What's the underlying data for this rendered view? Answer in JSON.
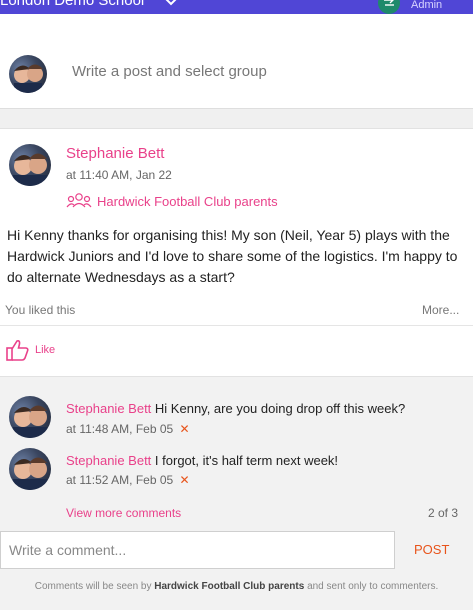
{
  "header": {
    "school_name": "London Demo School",
    "admin_label": "Admin",
    "bar_color": "#5046d6"
  },
  "composer": {
    "placeholder": "Write a post and select group"
  },
  "post": {
    "author": "Stephanie Bett",
    "time": "at 11:40 AM, Jan 22",
    "group": "Hardwick Football Club parents",
    "body": "Hi Kenny thanks for organising this! My son (Neil, Year 5) plays with the Hardwick Juniors and I'd love to share some of the logistics. I'm happy to do alternate Wednesdays as a start?",
    "liked_text": "You liked this",
    "more_label": "More...",
    "like_label": "Like"
  },
  "comments": {
    "items": [
      {
        "author": "Stephanie Bett",
        "text": "Hi Kenny, are you doing drop off this week?",
        "time": "at 11:48 AM, Feb 05",
        "delete_glyph": "✕"
      },
      {
        "author": "Stephanie Bett",
        "text": "I forgot, it's half term next week!",
        "time": "at 11:52 AM, Feb 05",
        "delete_glyph": "✕"
      }
    ],
    "view_more": "View more comments",
    "count": "2 of 3",
    "input_placeholder": "Write a comment...",
    "post_button": "POST",
    "note_prefix": "Comments will be seen by",
    "note_group": "Hardwick Football Club parents",
    "note_suffix": "and sent only to commenters."
  },
  "colors": {
    "accent": "#e9418a",
    "action": "#e8541b"
  }
}
